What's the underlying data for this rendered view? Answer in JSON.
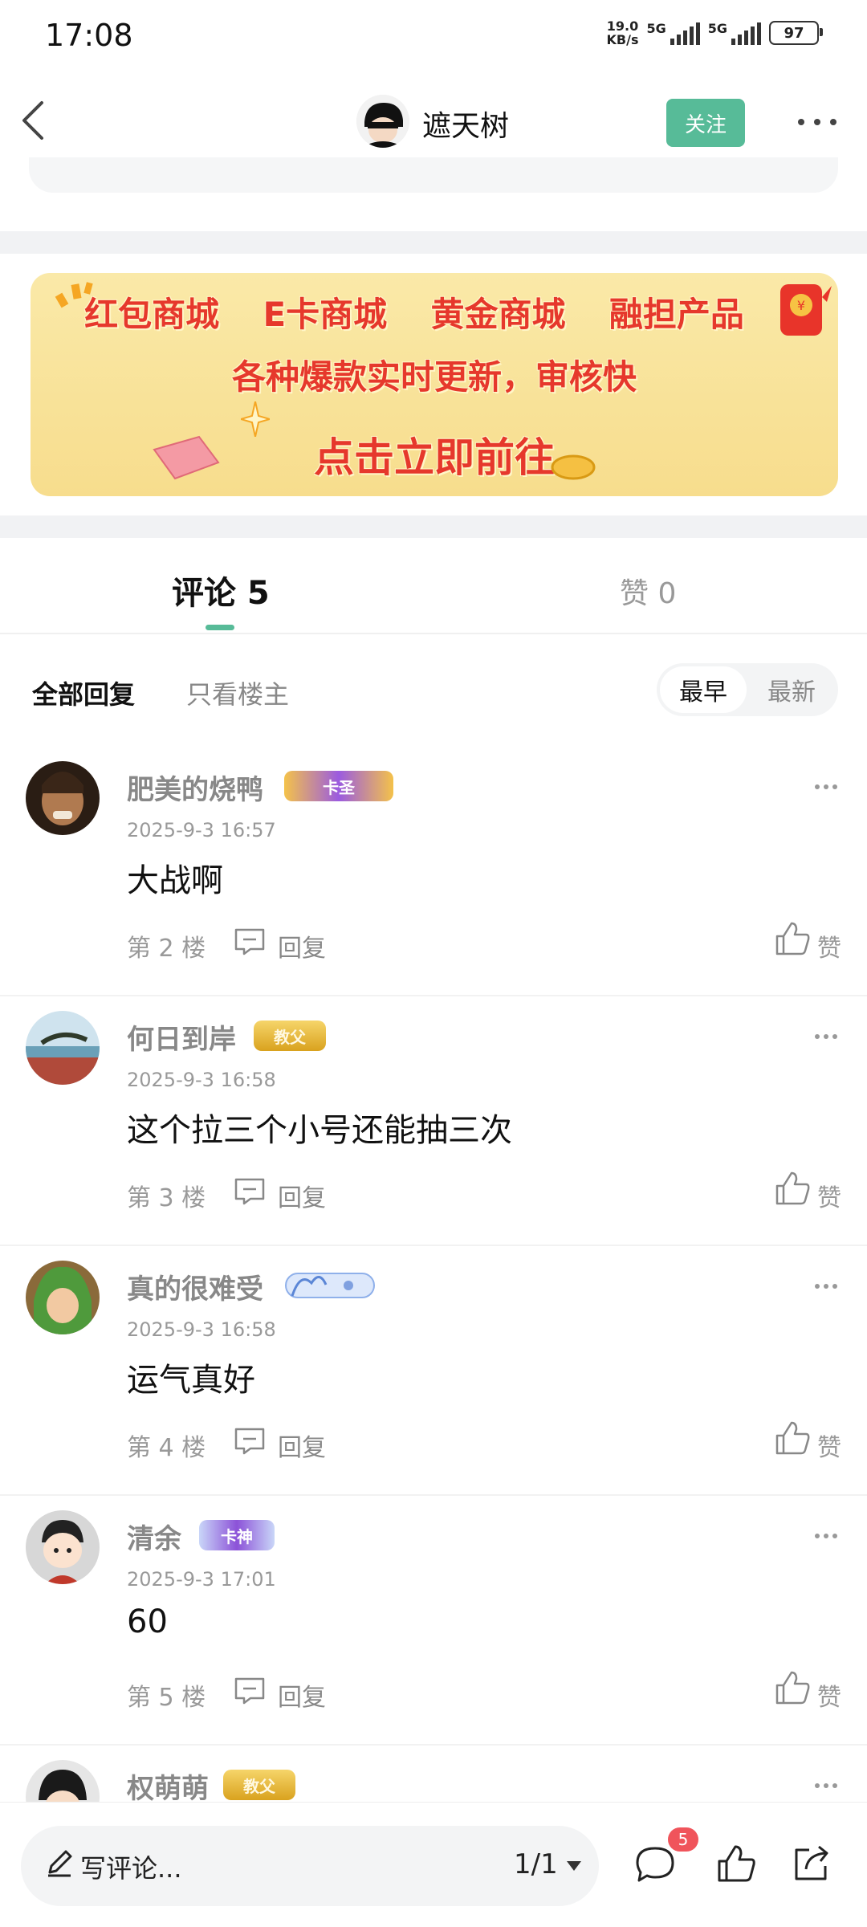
{
  "status_bar": {
    "time": "17:08",
    "net_speed_value": "19.0",
    "net_speed_unit": "KB/s",
    "sim1": "5G",
    "sim2": "5G",
    "battery": "97"
  },
  "header": {
    "author_name": "遮天树",
    "follow_label": "关注",
    "avatar_icon": "author-avatar-icon"
  },
  "banner": {
    "row1": [
      "红包商城",
      "E卡商城",
      "黄金商城",
      "融担产品"
    ],
    "row2": "各种爆款实时更新，审核快",
    "cta": "点击立即前往",
    "text_color": "#e6382c"
  },
  "tabs": {
    "comments_label": "评论 5",
    "likes_label": "赞 0",
    "accent": "#57bb98"
  },
  "filters": {
    "all": "全部回复",
    "owner_only": "只看楼主",
    "sort_earliest": "最早",
    "sort_latest": "最新"
  },
  "comments": [
    {
      "name": "肥美的烧鸭",
      "badge": "卡圣",
      "time": "2025-9-3 16:57",
      "text": "大战啊",
      "floor": "第 2 楼",
      "reply": "回复",
      "like": "赞"
    },
    {
      "name": "何日到岸",
      "badge": "教父",
      "time": "2025-9-3 16:58",
      "text": "这个拉三个小号还能抽三次",
      "floor": "第 3 楼",
      "reply": "回复",
      "like": "赞"
    },
    {
      "name": "真的很难受",
      "badge": "",
      "time": "2025-9-3 16:58",
      "text": "运气真好",
      "floor": "第 4 楼",
      "reply": "回复",
      "like": "赞"
    },
    {
      "name": "清余",
      "badge": "卡神",
      "time": "2025-9-3 17:01",
      "text": "60",
      "floor": "第 5 楼",
      "reply": "回复",
      "like": "赞"
    },
    {
      "name": "权萌萌",
      "badge": "教父",
      "time": "",
      "text": "",
      "floor": "",
      "reply": "",
      "like": ""
    }
  ],
  "bottom_bar": {
    "write_placeholder": "写评论...",
    "page": "1/1",
    "comment_count": "5"
  }
}
